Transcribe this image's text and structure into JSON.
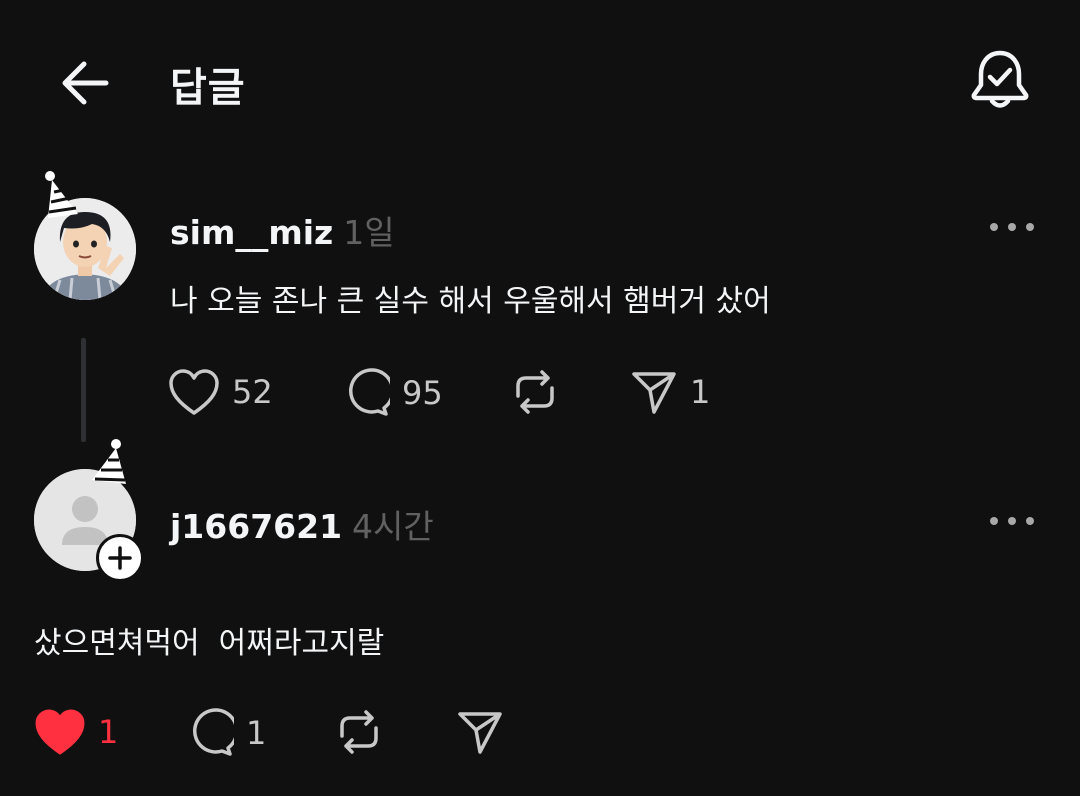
{
  "header": {
    "title": "답글",
    "back_icon": "arrow-left-icon",
    "notify_icon": "bell-check-icon"
  },
  "posts": [
    {
      "username": "sim__miz",
      "time": "1일",
      "text": "나 오늘 존나 큰 실수 해서 우울해서 햄버거 샀어",
      "likes": "52",
      "replies": "95",
      "reposts": "",
      "shares": "1",
      "liked": false
    },
    {
      "username": "j1667621",
      "time": "4시간",
      "text": "샀으면쳐먹어  어쩌라고지랄",
      "likes": "1",
      "replies": "1",
      "reposts": "",
      "shares": "",
      "liked": true
    }
  ],
  "colors": {
    "background": "#101010",
    "text": "#f3f5f7",
    "muted": "#616161",
    "like_active": "#ff3040"
  }
}
